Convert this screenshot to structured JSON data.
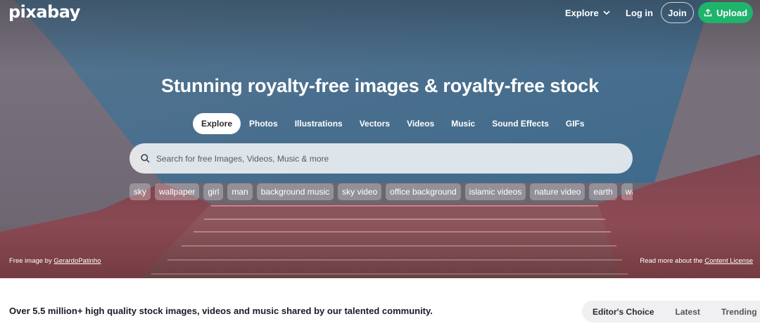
{
  "header": {
    "logo": "pixabay",
    "explore_label": "Explore",
    "login_label": "Log in",
    "join_label": "Join",
    "upload_label": "Upload"
  },
  "hero": {
    "title": "Stunning royalty-free images & royalty-free stock",
    "tabs": [
      {
        "label": "Explore",
        "active": true
      },
      {
        "label": "Photos"
      },
      {
        "label": "Illustrations"
      },
      {
        "label": "Vectors"
      },
      {
        "label": "Videos"
      },
      {
        "label": "Music"
      },
      {
        "label": "Sound Effects"
      },
      {
        "label": "GIFs"
      }
    ],
    "search_placeholder": "Search for free Images, Videos, Music & more",
    "chips": [
      "sky",
      "wallpaper",
      "girl",
      "man",
      "background music",
      "sky video",
      "office background",
      "islamic videos",
      "nature video",
      "earth",
      "wallpaper"
    ],
    "credit_prefix": "Free image by",
    "credit_author": "GerardoPatinho",
    "license_prefix": "Read more about the",
    "license_link": "Content License"
  },
  "main": {
    "tagline": "Over 5.5 million+ high quality stock images, videos and music shared by our talented community.",
    "sort_options": [
      "Editor's Choice",
      "Latest",
      "Trending"
    ]
  },
  "colors": {
    "upload_green": "#1fb36c",
    "hero_sky": "#4f6e8e",
    "hero_wall": "#8e4a52"
  },
  "icons": {
    "explore_chevron": "chevron-down-icon",
    "upload": "upload-icon",
    "search": "search-icon"
  }
}
